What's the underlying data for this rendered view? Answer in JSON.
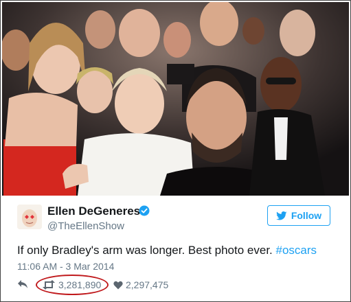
{
  "tweet": {
    "display_name": "Ellen DeGeneres",
    "handle": "@TheEllenShow",
    "follow_label": "Follow",
    "text_main": "If only Bradley's arm was longer. Best photo ever. ",
    "hashtag": "#oscars",
    "timestamp": "11:06 AM - 3 Mar 2014",
    "retweets": "3,281,890",
    "likes": "2,297,475"
  },
  "icons": {
    "verified": "verified-badge-icon",
    "follow": "twitter-bird-icon",
    "reply": "reply-icon",
    "retweet": "retweet-icon",
    "like": "heart-icon"
  },
  "colors": {
    "accent": "#1da1f2",
    "highlight_circle": "#c0191c",
    "muted_text": "#657786"
  }
}
